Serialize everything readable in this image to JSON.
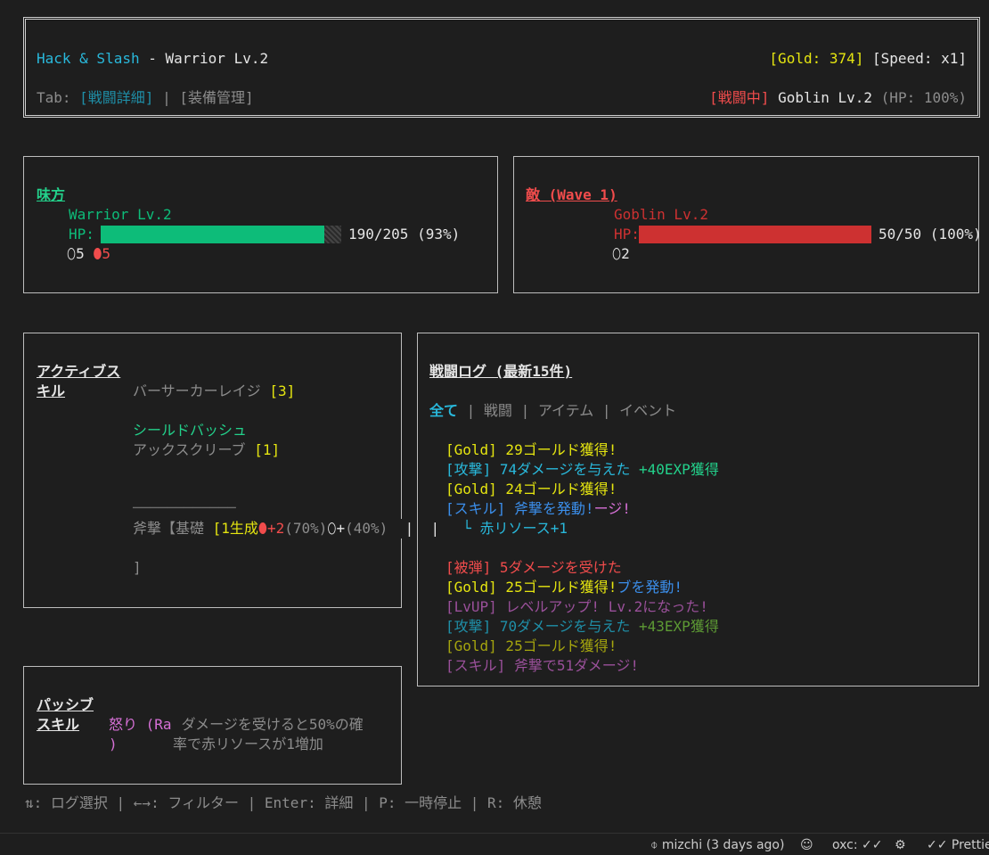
{
  "header": {
    "game_title": "Hack & Slash",
    "sep": " - ",
    "char_info": "Warrior Lv.2",
    "gold": "[Gold: 374]",
    "speed": "[Speed: x1]",
    "tab_label": "Tab: ",
    "tab_active": "[戦闘詳細]",
    "tab_sep": " | ",
    "tab_other": "[装備管理]",
    "battle_status": "[戦闘中]",
    "enemy_info": " Goblin Lv.2 ",
    "enemy_hp": "(HP: 100%)"
  },
  "ally": {
    "title": "味方",
    "name": "Warrior Lv.2",
    "hp_label": "HP:",
    "hp_text": "190/205 (93%)",
    "hp_fraction": 0.93,
    "res_white": "5",
    "res_red": "5"
  },
  "enemy": {
    "title": "敵 (Wave 1)",
    "name": "Goblin Lv.2",
    "hp_label": "HP:",
    "hp_text": "50/50 (100%)",
    "hp_fraction": 1.0,
    "res_white": "2"
  },
  "active_skills": {
    "title_line1": "アクティブス",
    "title_line2": "キル",
    "skill1_name": "バーサーカーレイジ ",
    "skill1_cost": "[3]",
    "skill2_name": "シールドバッシュ",
    "skill3_name": "アックスクリーブ ",
    "skill3_cost": "[1]",
    "divider": "────────────",
    "detail_prefix": "斧撃【基礎 ",
    "detail_bracket": "[1",
    "detail_gen": "生成",
    "detail_red_plus": "+2",
    "detail_p1": "(70%)",
    "detail_plus2": "+",
    "detail_p2": "(40%)",
    "detail_pipes": "  |  |",
    "detail_close": "]"
  },
  "log": {
    "title": "戦闘ログ (最新15件)",
    "filters": [
      "全て",
      "戦闘",
      "アイテム",
      "イベント"
    ],
    "filter_sep": " | ",
    "lines": [
      {
        "tag": "[Gold]",
        "text": " 29ゴールド獲得!",
        "extra": ""
      },
      {
        "tag": "[攻撃]",
        "text": " 74ダメージを与えた ",
        "extra": "+40EXP獲得"
      },
      {
        "tag": "[Gold]",
        "text": " 24ゴールド獲得!",
        "extra": ""
      },
      {
        "tag": "[スキル]",
        "text": " 斧撃を発動!",
        "extra": "ージ!"
      },
      {
        "tag": "",
        "text": "  └ 赤リソース+1",
        "extra": ""
      },
      {
        "tag": "[被弾]",
        "text": " 5ダメージを受けた",
        "extra": ""
      },
      {
        "tag": "[Gold]",
        "text": " 25ゴールド獲得!",
        "extra": "ブを発動!"
      },
      {
        "tag": "[LvUP]",
        "text": " レベルアップ! Lv.2になった!",
        "extra": ""
      },
      {
        "tag": "[攻撃]",
        "text": " 70ダメージを与えた ",
        "extra": "+43EXP獲得"
      },
      {
        "tag": "[Gold]",
        "text": " 25ゴールド獲得!",
        "extra": ""
      },
      {
        "tag": "[スキル]",
        "text": " 斧撃で51ダメージ!",
        "extra": ""
      }
    ]
  },
  "passive": {
    "title_line1": "パッシブ",
    "title_line2": "スキル",
    "name_line1": "怒り (Ra",
    "name_line2": ")",
    "desc_line1": " ダメージを受けると50%の確",
    "desc_line2": "率で赤リソースが1増加"
  },
  "help": "⇅: ログ選択 | ←→: フィルター | Enter: 詳細 | P: 一時停止 | R: 休憩",
  "statusbar": {
    "branch": "mizchi (3 days ago)",
    "oxc": "oxc: ✓✓",
    "prettier": "✓✓ Prettier"
  },
  "colors": {
    "ally_hp": "#0dbc79",
    "enemy_hp": "#cd3131",
    "cyan": "#29b8db"
  }
}
